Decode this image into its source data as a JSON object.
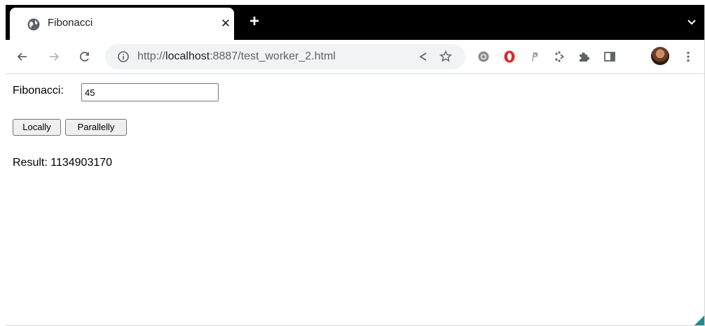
{
  "browser": {
    "tab": {
      "title": "Fibonacci"
    },
    "omnibox": {
      "scheme": "http://",
      "host": "localhost",
      "rest": ":8887/test_worker_2.html"
    },
    "toolbar_icons": [
      "back-icon",
      "forward-icon",
      "reload-icon",
      "info-icon",
      "share-icon",
      "star-icon",
      "extension-gear-icon",
      "opera-icon",
      "extension-p-icon",
      "extension-dots-icon",
      "puzzle-icon",
      "side-panel-icon",
      "menu-icon"
    ]
  },
  "page": {
    "fibonacci_label": "Fibonacci:",
    "fibonacci_value": "45",
    "locally_button": "Locally",
    "parallelly_button": "Parallelly",
    "result_text": "Result: 1134903170"
  },
  "colors": {
    "tabstrip": "#000000",
    "omnibox": "#f1f3f4",
    "accent_red": "#e52424"
  }
}
